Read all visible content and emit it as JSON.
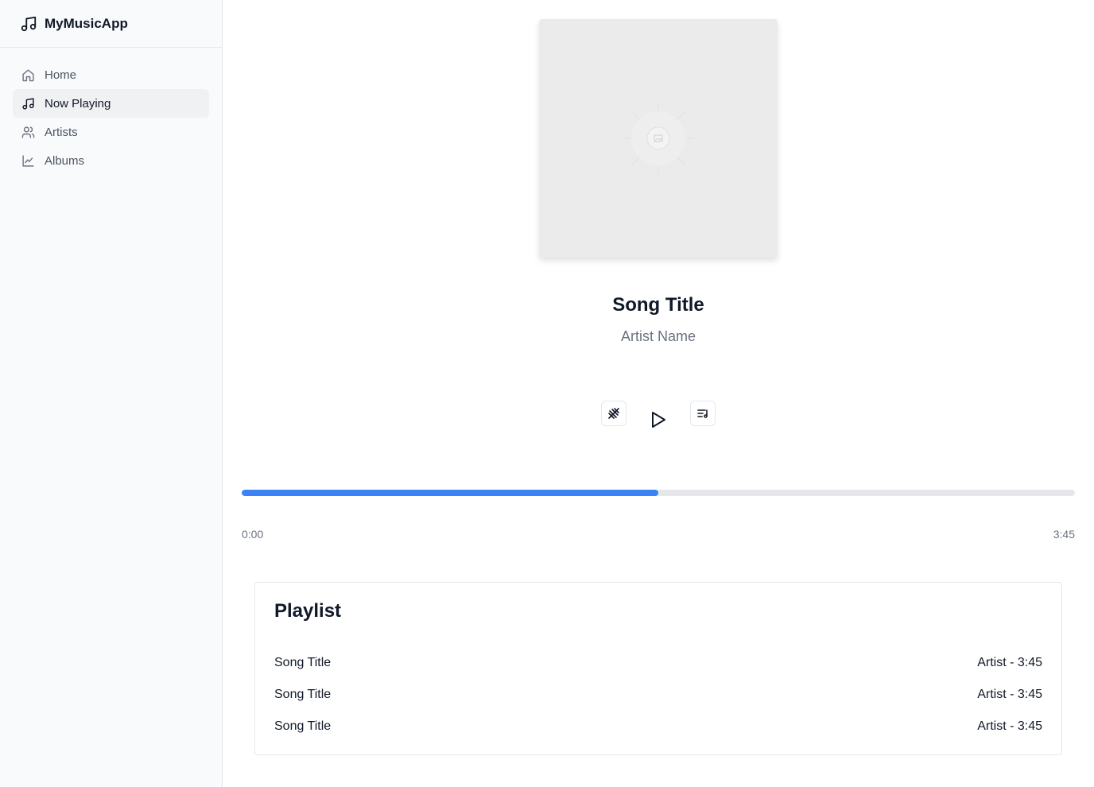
{
  "app": {
    "title": "MyMusicApp",
    "brand_icon": "music-note-icon"
  },
  "sidebar": {
    "items": [
      {
        "label": "Home",
        "icon": "home-icon",
        "active": false
      },
      {
        "label": "Now Playing",
        "icon": "music-note-icon",
        "active": true
      },
      {
        "label": "Artists",
        "icon": "users-icon",
        "active": false
      },
      {
        "label": "Albums",
        "icon": "chart-line-icon",
        "active": false
      }
    ]
  },
  "now_playing": {
    "title": "Song Title",
    "artist": "Artist Name",
    "controls": {
      "shuffle_icon": "shuffle-icon",
      "play_icon": "play-icon",
      "queue_icon": "playlist-icon"
    },
    "progress": {
      "fraction": 0.5,
      "current_time": "0:00",
      "duration": "3:45"
    }
  },
  "playlist": {
    "title": "Playlist",
    "tracks": [
      {
        "title": "Song Title",
        "meta": "Artist - 3:45"
      },
      {
        "title": "Song Title",
        "meta": "Artist - 3:45"
      },
      {
        "title": "Song Title",
        "meta": "Artist - 3:45"
      }
    ]
  },
  "colors": {
    "accent": "#3b82f6",
    "sidebar_bg": "#f9fafb",
    "active_item_bg": "#f0f1f3"
  }
}
